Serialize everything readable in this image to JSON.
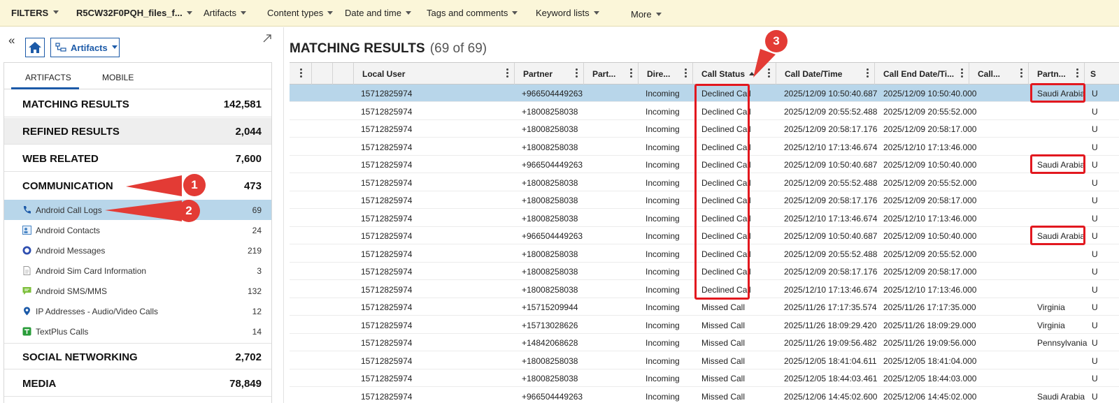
{
  "filterbar": {
    "filters_label": "FILTERS",
    "case_name": "R5CW32F0PQH_files_f...",
    "items": [
      "Artifacts",
      "Content types",
      "Date and time",
      "Tags and comments",
      "Keyword lists",
      "More"
    ]
  },
  "left": {
    "collapse_glyph": "«",
    "view_dropdown": "Artifacts",
    "tabs": [
      "ARTIFACTS",
      "MOBILE"
    ],
    "categories": [
      {
        "name": "MATCHING RESULTS",
        "count": "142,581"
      },
      {
        "name": "REFINED RESULTS",
        "count": "2,044"
      },
      {
        "name": "WEB RELATED",
        "count": "7,600"
      },
      {
        "name": "COMMUNICATION",
        "count": "473"
      },
      {
        "name": "SOCIAL NETWORKING",
        "count": "2,702"
      },
      {
        "name": "MEDIA",
        "count": "78,849"
      }
    ],
    "communication_items": [
      {
        "name": "Android Call Logs",
        "count": "69",
        "icon": "phone-icon"
      },
      {
        "name": "Android Contacts",
        "count": "24",
        "icon": "contacts-icon"
      },
      {
        "name": "Android Messages",
        "count": "219",
        "icon": "messages-icon"
      },
      {
        "name": "Android Sim Card Information",
        "count": "3",
        "icon": "document-icon"
      },
      {
        "name": "Android SMS/MMS",
        "count": "132",
        "icon": "sms-icon"
      },
      {
        "name": "IP Addresses - Audio/Video Calls",
        "count": "12",
        "icon": "location-pin-icon"
      },
      {
        "name": "TextPlus Calls",
        "count": "14",
        "icon": "textplus-icon"
      }
    ]
  },
  "callouts": [
    "1",
    "2",
    "3"
  ],
  "main": {
    "title": "MATCHING RESULTS",
    "count": "(69 of 69)",
    "columns": [
      "Local User",
      "Partner",
      "Part...",
      "Dire...",
      "Call Status",
      "Call Date/Time",
      "Call End Date/Ti...",
      "Call...",
      "Partn...",
      "S"
    ],
    "rows": [
      [
        "15712825974",
        "+966504449263",
        "Incoming",
        "Declined Call",
        "2025/12/09 10:50:40.687",
        "2025/12/09 10:50:40.000",
        "Saudi Arabia",
        "U"
      ],
      [
        "15712825974",
        "+18008258038",
        "Incoming",
        "Declined Call",
        "2025/12/09 20:55:52.488",
        "2025/12/09 20:55:52.000",
        "",
        "U"
      ],
      [
        "15712825974",
        "+18008258038",
        "Incoming",
        "Declined Call",
        "2025/12/09 20:58:17.176",
        "2025/12/09 20:58:17.000",
        "",
        "U"
      ],
      [
        "15712825974",
        "+18008258038",
        "Incoming",
        "Declined Call",
        "2025/12/10 17:13:46.674",
        "2025/12/10 17:13:46.000",
        "",
        "U"
      ],
      [
        "15712825974",
        "+966504449263",
        "Incoming",
        "Declined Call",
        "2025/12/09 10:50:40.687",
        "2025/12/09 10:50:40.000",
        "Saudi Arabia",
        "U"
      ],
      [
        "15712825974",
        "+18008258038",
        "Incoming",
        "Declined Call",
        "2025/12/09 20:55:52.488",
        "2025/12/09 20:55:52.000",
        "",
        "U"
      ],
      [
        "15712825974",
        "+18008258038",
        "Incoming",
        "Declined Call",
        "2025/12/09 20:58:17.176",
        "2025/12/09 20:58:17.000",
        "",
        "U"
      ],
      [
        "15712825974",
        "+18008258038",
        "Incoming",
        "Declined Call",
        "2025/12/10 17:13:46.674",
        "2025/12/10 17:13:46.000",
        "",
        "U"
      ],
      [
        "15712825974",
        "+966504449263",
        "Incoming",
        "Declined Call",
        "2025/12/09 10:50:40.687",
        "2025/12/09 10:50:40.000",
        "Saudi Arabia",
        "U"
      ],
      [
        "15712825974",
        "+18008258038",
        "Incoming",
        "Declined Call",
        "2025/12/09 20:55:52.488",
        "2025/12/09 20:55:52.000",
        "",
        "U"
      ],
      [
        "15712825974",
        "+18008258038",
        "Incoming",
        "Declined Call",
        "2025/12/09 20:58:17.176",
        "2025/12/09 20:58:17.000",
        "",
        "U"
      ],
      [
        "15712825974",
        "+18008258038",
        "Incoming",
        "Declined Call",
        "2025/12/10 17:13:46.674",
        "2025/12/10 17:13:46.000",
        "",
        "U"
      ],
      [
        "15712825974",
        "+15715209944",
        "Incoming",
        "Missed Call",
        "2025/11/26 17:17:35.574",
        "2025/11/26 17:17:35.000",
        "Virginia",
        "U"
      ],
      [
        "15712825974",
        "+15713028626",
        "Incoming",
        "Missed Call",
        "2025/11/26 18:09:29.420",
        "2025/11/26 18:09:29.000",
        "Virginia",
        "U"
      ],
      [
        "15712825974",
        "+14842068628",
        "Incoming",
        "Missed Call",
        "2025/11/26 19:09:56.482",
        "2025/11/26 19:09:56.000",
        "Pennsylvania",
        "U"
      ],
      [
        "15712825974",
        "+18008258038",
        "Incoming",
        "Missed Call",
        "2025/12/05 18:41:04.611",
        "2025/12/05 18:41:04.000",
        "",
        "U"
      ],
      [
        "15712825974",
        "+18008258038",
        "Incoming",
        "Missed Call",
        "2025/12/05 18:44:03.461",
        "2025/12/05 18:44:03.000",
        "",
        "U"
      ],
      [
        "15712825974",
        "+966504449263",
        "Incoming",
        "Missed Call",
        "2025/12/06 14:45:02.600",
        "2025/12/06 14:45:02.000",
        "Saudi Arabia",
        "U"
      ]
    ]
  },
  "colors": {
    "filterbar_bg": "#fbf6d9",
    "selection": "#b8d6ea",
    "accent_blue": "#1c5aa8",
    "annotation_red": "#e2181f",
    "callout_red": "#e33b35"
  }
}
